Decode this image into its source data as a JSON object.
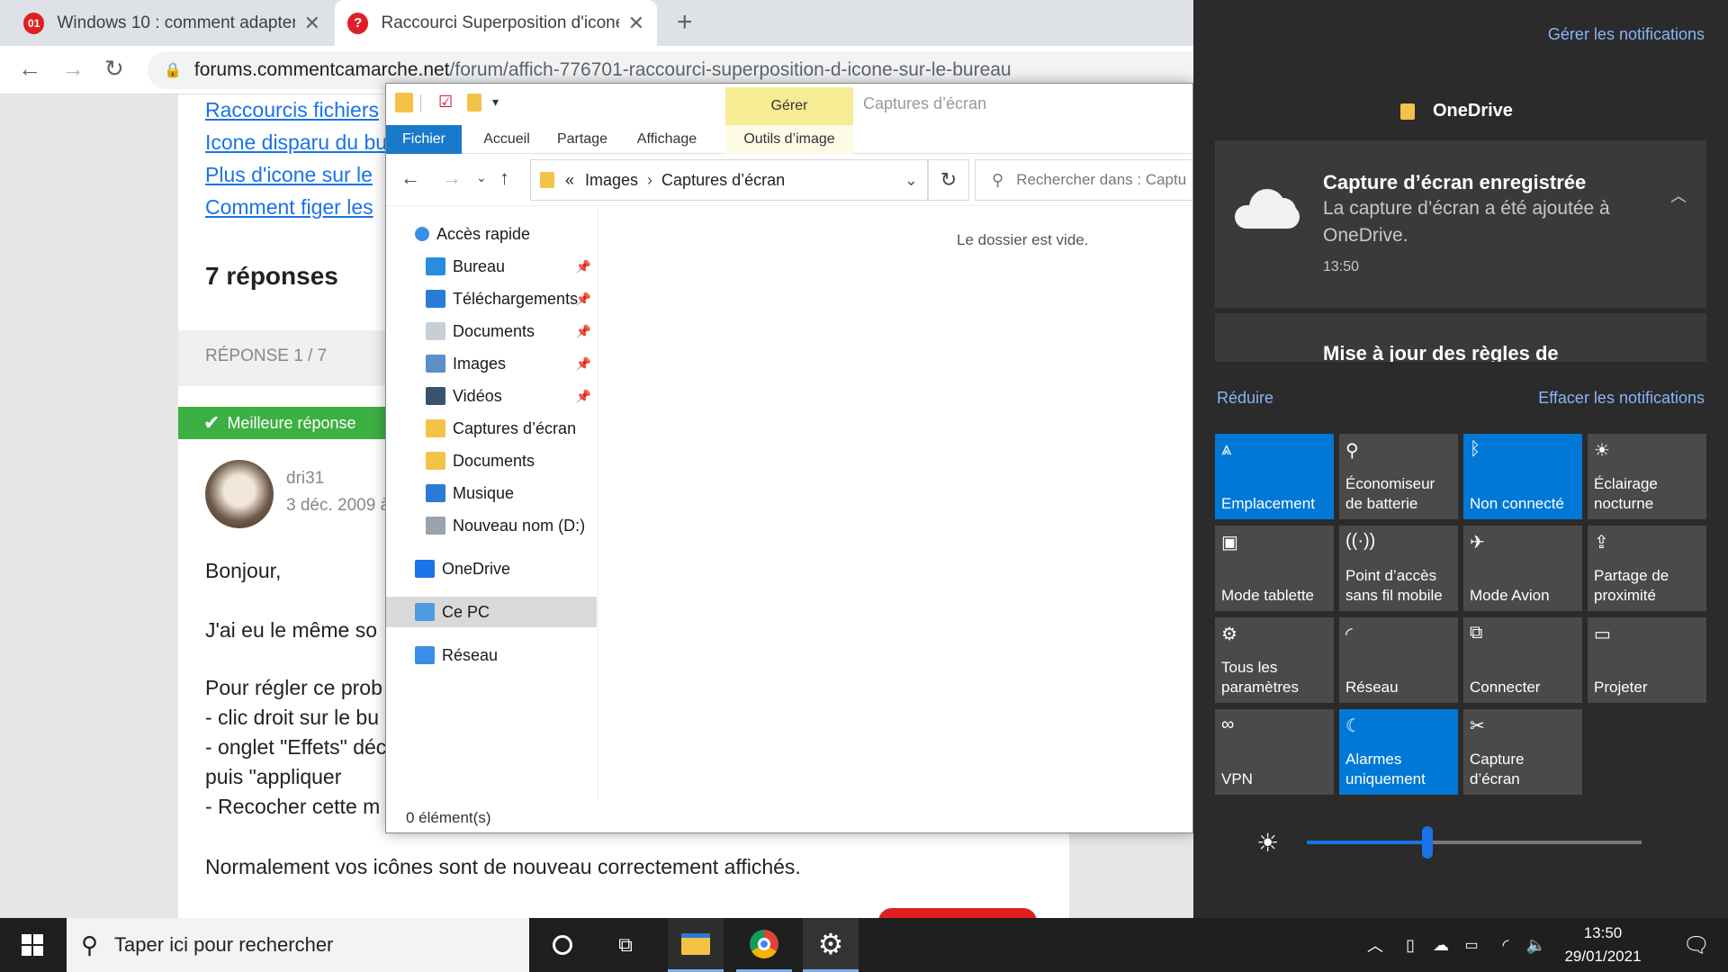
{
  "browser": {
    "tabs": [
      {
        "favicon": "01",
        "favicon_color": "#e02020",
        "title": "Windows 10 : comment adapter l"
      },
      {
        "favicon": "?",
        "favicon_color": "#e01e2a",
        "title": "Raccourci Superposition d'icone"
      }
    ],
    "new_tab": "+",
    "url_domain": "forums.commentcamarche.net",
    "url_path": "/forum/affich-776701-raccourci-superposition-d-icone-sur-le-bureau"
  },
  "article": {
    "related_links": [
      "Raccourcis fichiers",
      "Icone disparu du bu",
      "Plus d'icone sur le",
      "Comment figer les"
    ],
    "answers_title": "7 réponses",
    "reply_index": "RÉPONSE 1 / 7",
    "best_answer": "Meilleure réponse",
    "author": "dri31",
    "date": "3 déc. 2009 à",
    "lines": [
      "Bonjour,",
      "J'ai eu le même so",
      "Pour régler ce prob",
      "- clic droit sur le bu",
      "- onglet \"Effets\" déc",
      "puis \"appliquer",
      "- Recocher cette m",
      "Normalement vos icônes sont de nouveau correctement affichés."
    ]
  },
  "explorer": {
    "manage_label": "Gérer",
    "window_title": "Captures d’écran",
    "tabs": [
      "Fichier",
      "Accueil",
      "Partage",
      "Affichage",
      "Outils d’image"
    ],
    "breadcrumb_prefix": "«",
    "breadcrumb": [
      "Images",
      "Captures d’écran"
    ],
    "search_placeholder": "Rechercher dans : Captu",
    "empty_text": "Le dossier est vide.",
    "status": "0 élément(s)",
    "nav": [
      {
        "label": "Accès rapide",
        "icon": "star-icon",
        "color": "#3a8ee6",
        "pinned": false,
        "indent": 0
      },
      {
        "label": "Bureau",
        "icon": "desktop-icon",
        "color": "#2a8ce0",
        "pinned": true,
        "indent": 1
      },
      {
        "label": "Téléchargements",
        "icon": "download-icon",
        "color": "#2a7ad8",
        "pinned": true,
        "indent": 1
      },
      {
        "label": "Documents",
        "icon": "document-icon",
        "color": "#c8ced6",
        "pinned": true,
        "indent": 1
      },
      {
        "label": "Images",
        "icon": "image-icon",
        "color": "#5a8fc8",
        "pinned": true,
        "indent": 1
      },
      {
        "label": "Vidéos",
        "icon": "video-icon",
        "color": "#3a5170",
        "pinned": true,
        "indent": 1
      },
      {
        "label": "Captures d’écran",
        "icon": "folder-icon",
        "color": "#f3c347",
        "pinned": false,
        "indent": 1
      },
      {
        "label": "Documents",
        "icon": "folder-icon",
        "color": "#f3c347",
        "pinned": false,
        "indent": 1
      },
      {
        "label": "Musique",
        "icon": "music-icon",
        "color": "#2a7ad8",
        "pinned": false,
        "indent": 1
      },
      {
        "label": "Nouveau nom (D:)",
        "icon": "drive-icon",
        "color": "#9aa3ad",
        "pinned": false,
        "indent": 1
      },
      {
        "label": "OneDrive",
        "icon": "cloud-icon",
        "color": "#1a73e8",
        "pinned": false,
        "indent": 0
      },
      {
        "label": "Ce PC",
        "icon": "pc-icon",
        "color": "#4d9be0",
        "pinned": false,
        "indent": 0,
        "selected": true
      },
      {
        "label": "Réseau",
        "icon": "network-icon",
        "color": "#3a8ee6",
        "pinned": false,
        "indent": 0
      }
    ]
  },
  "action_center": {
    "manage_notifications": "Gérer les notifications",
    "app_name": "OneDrive",
    "notification": {
      "title": "Capture d’écran enregistrée",
      "body_line1": "La capture d’écran a été ajoutée à",
      "body_line2": "OneDrive.",
      "time": "13:50"
    },
    "notification2_title": "Mise à jour des règles de",
    "collapse": "Réduire",
    "clear": "Effacer les notifications",
    "quick_actions": [
      {
        "label1": "",
        "label2": "Emplacement",
        "icon": "location-icon",
        "glyph": "⩓",
        "on": true
      },
      {
        "label1": "Économiseur",
        "label2": "de batterie",
        "icon": "battery-saver-icon",
        "glyph": "⚲",
        "on": false
      },
      {
        "label1": "",
        "label2": "Non connecté",
        "icon": "bluetooth-icon",
        "glyph": "ᛒ",
        "on": true
      },
      {
        "label1": "Éclairage",
        "label2": "nocturne",
        "icon": "night-light-icon",
        "glyph": "☀",
        "on": false
      },
      {
        "label1": "",
        "label2": "Mode tablette",
        "icon": "tablet-mode-icon",
        "glyph": "▣",
        "on": false
      },
      {
        "label1": "Point d’accès",
        "label2": "sans fil mobile",
        "icon": "hotspot-icon",
        "glyph": "((·))",
        "on": false
      },
      {
        "label1": "",
        "label2": "Mode Avion",
        "icon": "airplane-icon",
        "glyph": "✈",
        "on": false
      },
      {
        "label1": "Partage de",
        "label2": "proximité",
        "icon": "nearby-share-icon",
        "glyph": "⇪",
        "on": false
      },
      {
        "label1": "Tous les",
        "label2": "paramètres",
        "icon": "settings-icon",
        "glyph": "⚙",
        "on": false
      },
      {
        "label1": "",
        "label2": "Réseau",
        "icon": "network-icon",
        "glyph": "◜",
        "on": false
      },
      {
        "label1": "",
        "label2": "Connecter",
        "icon": "connect-icon",
        "glyph": "⧉",
        "on": false
      },
      {
        "label1": "",
        "label2": "Projeter",
        "icon": "project-icon",
        "glyph": "▭",
        "on": false
      },
      {
        "label1": "",
        "label2": "VPN",
        "icon": "vpn-icon",
        "glyph": "∞",
        "on": false
      },
      {
        "label1": "Alarmes",
        "label2": "uniquement",
        "icon": "moon-icon",
        "glyph": "☾",
        "on": true
      },
      {
        "label1": "Capture",
        "label2": "d’écran",
        "icon": "screen-snip-icon",
        "glyph": "✂",
        "on": false
      }
    ],
    "brightness": 0.36
  },
  "taskbar": {
    "search_placeholder": "Taper ici pour rechercher",
    "time": "13:50",
    "date": "29/01/2021"
  }
}
